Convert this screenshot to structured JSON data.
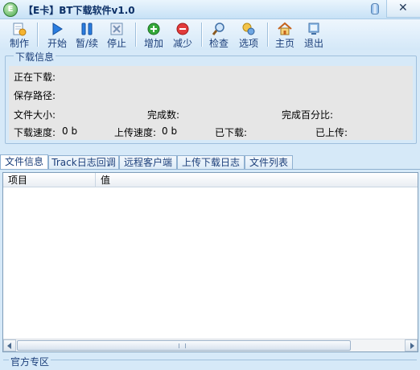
{
  "window": {
    "title": "【E卡】BT下载软件v1.0",
    "icon_text": "E",
    "close_symbol": "✕"
  },
  "toolbar": {
    "make": "制作",
    "start": "开始",
    "pause_resume": "暂/续",
    "stop": "停止",
    "add": "增加",
    "reduce": "减少",
    "check": "检查",
    "options": "选项",
    "home": "主页",
    "exit": "退出"
  },
  "download_info": {
    "legend": "下载信息",
    "downloading_label": "正在下载:",
    "save_path_label": "保存路径:",
    "file_size_label": "文件大小:",
    "completed_count_label": "完成数:",
    "completed_percent_label": "完成百分比:",
    "download_speed_label": "下载速度:",
    "download_speed_value": "0 b",
    "upload_speed_label": "上传速度:",
    "upload_speed_value": "0 b",
    "downloaded_label": "已下载:",
    "uploaded_label": "已上传:"
  },
  "tabs": [
    {
      "label": "文件信息"
    },
    {
      "label": "Track日志回调"
    },
    {
      "label": "远程客户端"
    },
    {
      "label": "上传下载日志"
    },
    {
      "label": "文件列表"
    }
  ],
  "list": {
    "columns": [
      "项目",
      "值"
    ]
  },
  "footer": {
    "legend": "官方专区"
  }
}
